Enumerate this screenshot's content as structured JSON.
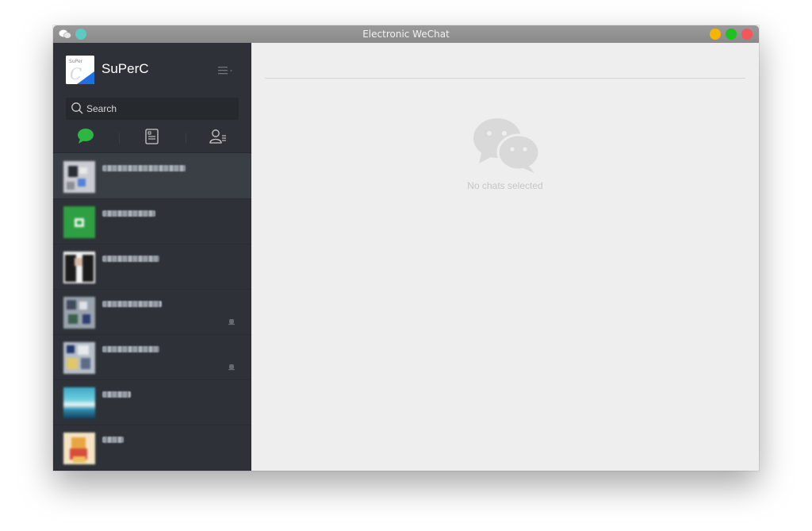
{
  "window": {
    "title": "Electronic WeChat"
  },
  "profile": {
    "name": "SuPerC"
  },
  "search": {
    "placeholder": "Search"
  },
  "tabs": [
    "chat-icon",
    "contacts-list-icon",
    "profile-icon"
  ],
  "chat_list": [
    {
      "active": true,
      "muted": false
    },
    {
      "active": false,
      "muted": false
    },
    {
      "active": false,
      "muted": false
    },
    {
      "active": false,
      "muted": true
    },
    {
      "active": false,
      "muted": true
    },
    {
      "active": false,
      "muted": false
    },
    {
      "active": false,
      "muted": false
    }
  ],
  "main": {
    "empty_text": "No chats selected"
  },
  "colors": {
    "accent": "#2eb640",
    "sidebar_bg": "#2e3238",
    "main_bg": "#eeeeee"
  }
}
